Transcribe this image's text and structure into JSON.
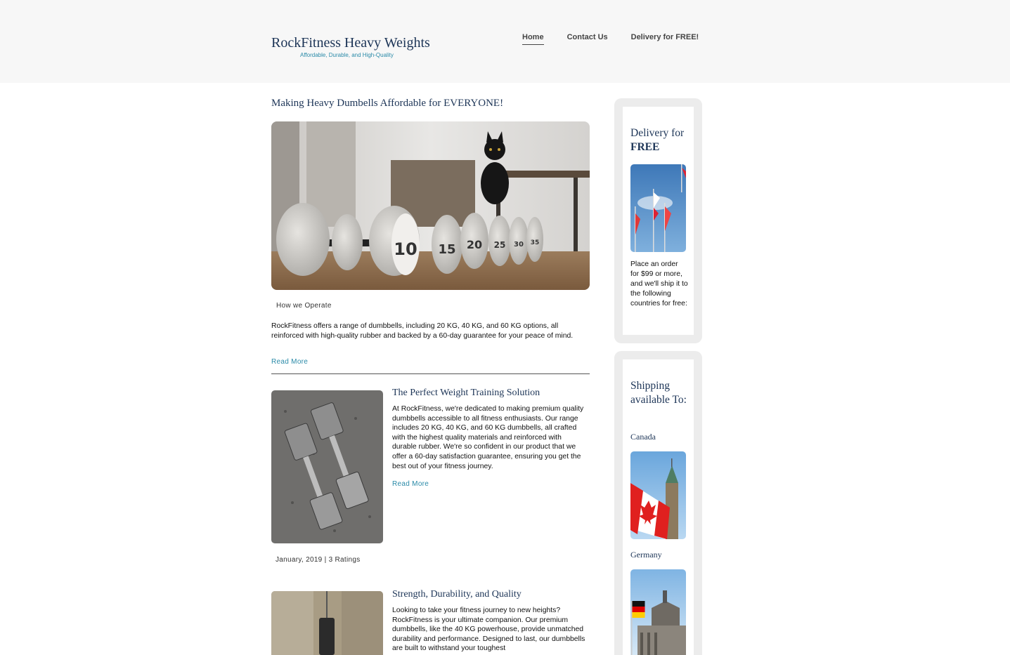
{
  "header": {
    "brand_title": "RockFitness Heavy Weights",
    "brand_tagline": "Affordable, Durable, and High-Quality",
    "nav": [
      "Home",
      "Contact Us",
      "Delivery for FREE!"
    ]
  },
  "hero": {
    "title": "Making Heavy Dumbells Affordable for EVERYONE!",
    "image_alt": "cat-and-concrete-dumbbells-photo",
    "dumbbell_labels": [
      "10",
      "15",
      "20",
      "25",
      "30",
      "35"
    ],
    "caption": "How we Operate",
    "text": "RockFitness offers a range of dumbbells, including 20 KG, 40 KG, and 60 KG options, all reinforced with high-quality rubber and backed by a 60-day guarantee for your peace of mind.",
    "read_more": "Read More"
  },
  "articles": [
    {
      "title": "The Perfect Weight Training Solution",
      "text": "At RockFitness, we're dedicated to making premium quality dumbbells accessible to all fitness enthusiasts. Our range includes 20 KG, 40 KG, and 60 KG dumbbells, all crafted with the highest quality materials and reinforced with durable rubber. We're so confident in our product that we offer a 60-day satisfaction guarantee, ensuring you get the best out of your fitness journey.",
      "read_more": "Read More",
      "meta": "January, 2019 | 3 Ratings"
    },
    {
      "title": "Strength, Durability, and Quality",
      "text": "Looking to take your fitness journey to new heights? RockFitness is your ultimate companion. Our premium dumbbells, like the 40 KG powerhouse, provide unmatched durability and performance. Designed to last, our dumbbells are built to withstand your toughest"
    }
  ],
  "sidebar": {
    "delivery": {
      "heading_prefix": "Delivery for",
      "heading_bold": "FREE",
      "text": "Place an order for $99 or more, and we'll ship it to the following countries for free:"
    },
    "shipping": {
      "heading": "Shipping available To:",
      "countries": [
        "Canada",
        "Germany"
      ]
    }
  },
  "colors": {
    "header_bg": "#f7f7f7",
    "title_navy": "#1d3557",
    "link_teal": "#2a8aa8",
    "sidebar_frame": "#ececec"
  }
}
